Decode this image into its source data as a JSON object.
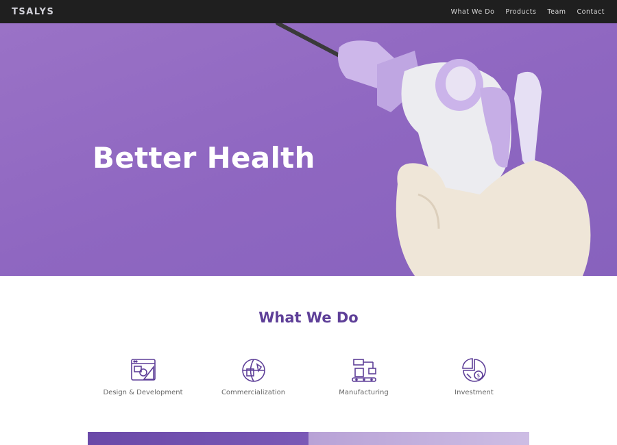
{
  "nav": {
    "logo": "TSALYS",
    "links": [
      "What We Do",
      "Products",
      "Team",
      "Contact"
    ]
  },
  "hero": {
    "title": "Better Health",
    "image": "gloved-hand-holding-medical-device"
  },
  "what_we_do": {
    "title": "What We Do",
    "services": [
      {
        "label": "Design & Development",
        "icon": "design-development-icon"
      },
      {
        "label": "Commercialization",
        "icon": "commercialization-icon"
      },
      {
        "label": "Manufacturing",
        "icon": "manufacturing-icon"
      },
      {
        "label": "Investment",
        "icon": "investment-icon"
      }
    ]
  },
  "colors": {
    "brand_purple": "#5e3f98",
    "hero_purple": "#9a72c6",
    "nav_bg": "#1f1f1f"
  }
}
